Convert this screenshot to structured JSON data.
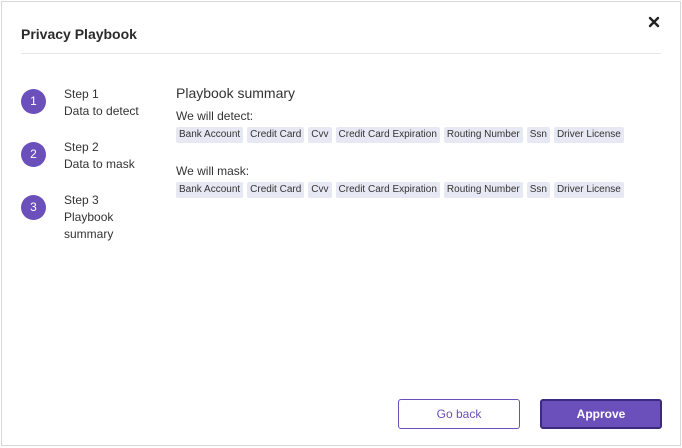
{
  "dialog": {
    "title": "Privacy Playbook",
    "close_icon": "close-icon"
  },
  "steps": [
    {
      "number": "1",
      "label": "Step 1",
      "name": "Data to detect"
    },
    {
      "number": "2",
      "label": "Step 2",
      "name": "Data to mask"
    },
    {
      "number": "3",
      "label": "Step 3",
      "name": "Playbook summary"
    }
  ],
  "summary": {
    "title": "Playbook summary",
    "detect_label": "We will detect:",
    "detect_items": [
      "Bank Account",
      "Credit Card",
      "Cvv",
      "Credit Card Expiration",
      "Routing Number",
      "Ssn",
      "Driver License"
    ],
    "mask_label": "We will mask:",
    "mask_items": [
      "Bank Account",
      "Credit Card",
      "Cvv",
      "Credit Card Expiration",
      "Routing Number",
      "Ssn",
      "Driver License"
    ]
  },
  "buttons": {
    "back_label": "Go back",
    "approve_label": "Approve"
  },
  "colors": {
    "accent": "#6b4fbb",
    "chip_bg": "#e6e9f3",
    "approve_border": "#3b2a80"
  }
}
